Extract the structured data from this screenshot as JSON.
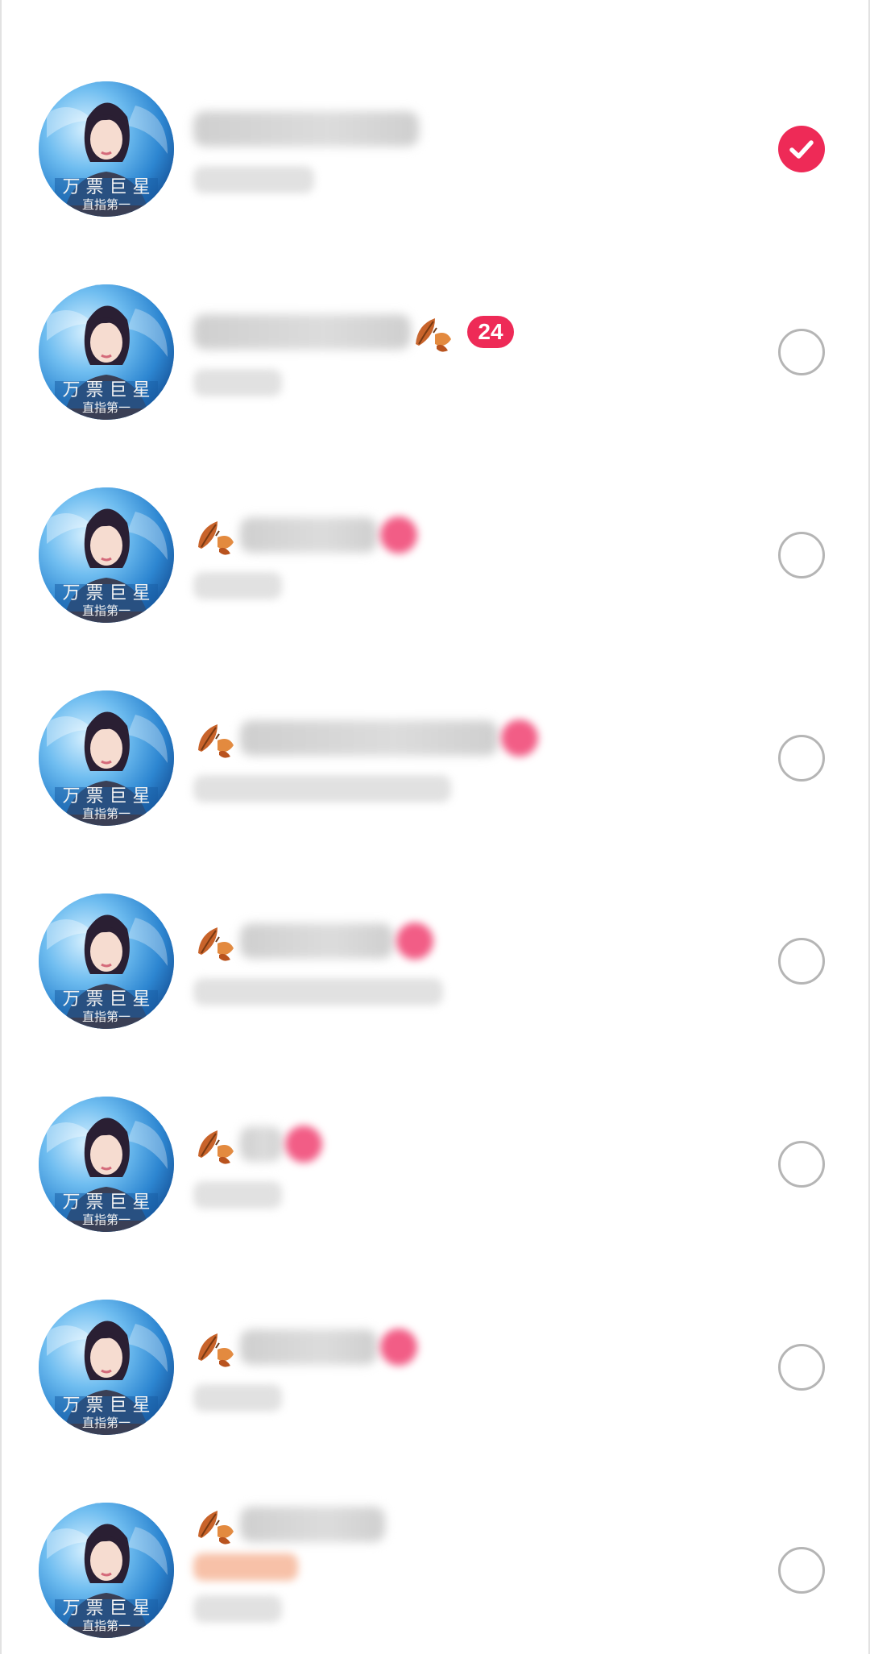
{
  "colors": {
    "accent": "#ee2a57",
    "radio_border": "#b5b5b5",
    "background": "#ffffff"
  },
  "rows": [
    {
      "avatar_icon": "avatar-portrait",
      "name_blurred": true,
      "selected": true,
      "badge": ""
    },
    {
      "avatar_icon": "avatar-portrait",
      "name_blurred": true,
      "selected": false,
      "badge": "24"
    },
    {
      "avatar_icon": "avatar-portrait",
      "name_blurred": true,
      "selected": false,
      "badge": ""
    },
    {
      "avatar_icon": "avatar-portrait",
      "name_blurred": true,
      "selected": false,
      "badge": ""
    },
    {
      "avatar_icon": "avatar-portrait",
      "name_blurred": true,
      "selected": false,
      "badge": ""
    },
    {
      "avatar_icon": "avatar-portrait",
      "name_blurred": true,
      "selected": false,
      "badge": ""
    },
    {
      "avatar_icon": "avatar-portrait",
      "name_blurred": true,
      "selected": false,
      "badge": ""
    },
    {
      "avatar_icon": "avatar-portrait",
      "name_blurred": true,
      "selected": false,
      "badge": ""
    }
  ],
  "icons": {
    "leaf": "autumn-leaf-icon",
    "check": "checkmark-icon"
  }
}
